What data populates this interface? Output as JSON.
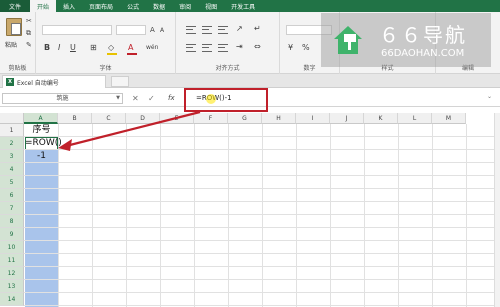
{
  "ribbon_tabs": [
    "文件",
    "开始",
    "插入",
    "页面布局",
    "公式",
    "数据",
    "审阅",
    "视图",
    "开发工具"
  ],
  "ribbon_groups": {
    "clipboard": "剪贴板",
    "font": "字体",
    "alignment": "对齐方式",
    "number": "数字",
    "styles": "样式",
    "editing": "编辑"
  },
  "paste_label": "粘贴",
  "document_tab": "Excel 自动编号",
  "name_box": "筑施",
  "formula": "=ROW()-1",
  "watermark": {
    "title": "６６导航",
    "subtitle": "66DAOHAN.COM"
  },
  "columns": [
    "A",
    "B",
    "C",
    "D",
    "E",
    "F",
    "G",
    "H",
    "I",
    "J",
    "K",
    "L",
    "M"
  ],
  "rows": [
    "1",
    "2",
    "3",
    "4",
    "5",
    "6",
    "7",
    "8",
    "9",
    "10",
    "11",
    "12",
    "13",
    "14"
  ],
  "cells": {
    "a1": "序号",
    "a2": "=ROW()",
    "a3": "-1"
  },
  "colors": {
    "excel_green": "#217346",
    "selection_blue": "#a9c4eb",
    "annotation_red": "#c0202a"
  }
}
